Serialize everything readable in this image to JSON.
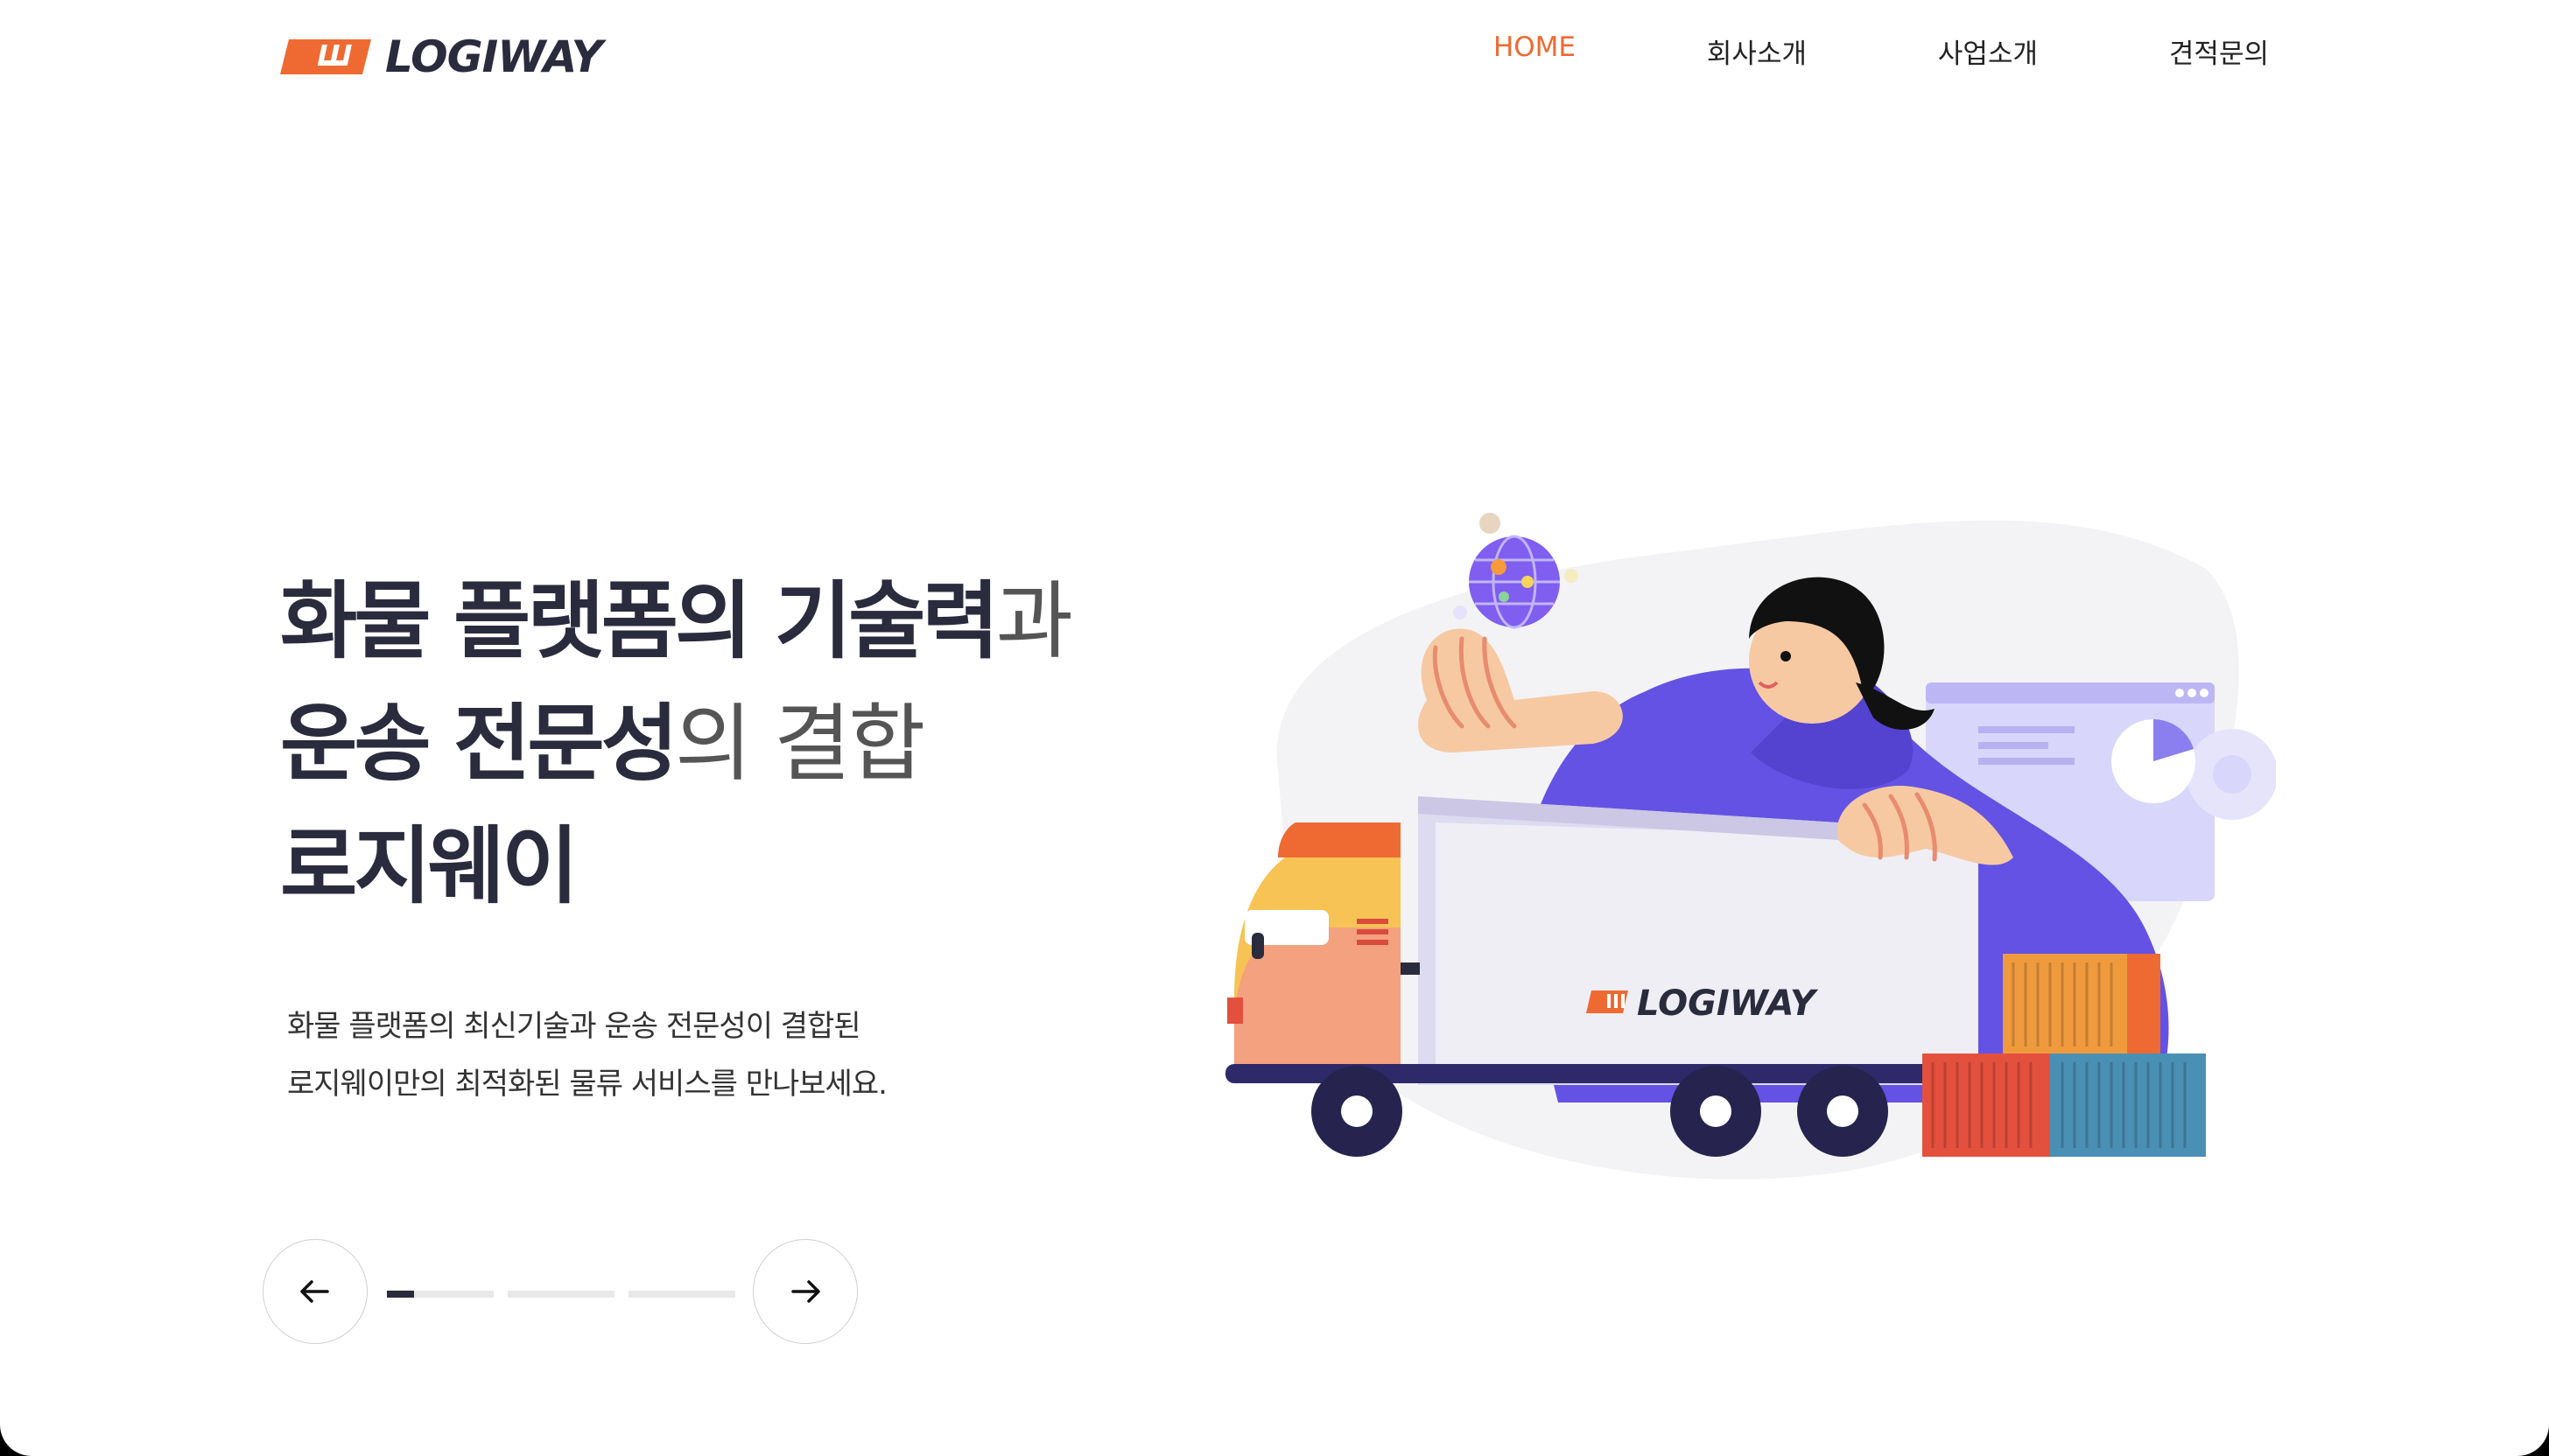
{
  "header": {
    "logo_text": "LOGIWAY",
    "nav": [
      {
        "label": "HOME",
        "active": true
      },
      {
        "label": "회사소개",
        "active": false
      },
      {
        "label": "사업소개",
        "active": false
      },
      {
        "label": "견적문의",
        "active": false
      }
    ]
  },
  "hero": {
    "line1_bold": "화물 플랫폼의 기술력",
    "line1_light": "과",
    "line2_bold": "운송 전문성",
    "line2_light": "의 결합",
    "line3_bold": "로지웨이",
    "desc_line1": "화물 플랫폼의 최신기술과 운송 전문성이 결합된",
    "desc_line2": "로지웨이만의 최적화된 물류 서비스를 만나보세요."
  },
  "illustration": {
    "truck_logo_text": "LOGIWAY"
  },
  "slider": {
    "slide_count": 3,
    "current_slide": 1,
    "current_progress": 0.25,
    "prev_icon": "arrow-left-icon",
    "next_icon": "arrow-right-icon"
  },
  "colors": {
    "accent": "#ee6a32",
    "dark": "#2a2b3d",
    "purple": "#6452e4"
  }
}
